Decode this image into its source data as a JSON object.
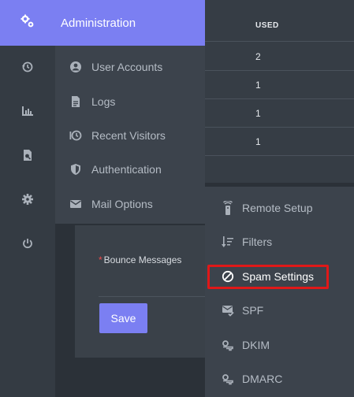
{
  "header": {
    "title": "Administration"
  },
  "rail": {
    "icons": [
      "gears-icon",
      "history-icon",
      "bar-chart-icon",
      "search-file-icon",
      "gear-icon",
      "power-icon"
    ]
  },
  "admin_menu": {
    "items": [
      {
        "label": "User Accounts",
        "icon": "user-circle-icon"
      },
      {
        "label": "Logs",
        "icon": "file-icon"
      },
      {
        "label": "Recent Visitors",
        "icon": "history-icon"
      },
      {
        "label": "Authentication",
        "icon": "shield-icon"
      },
      {
        "label": "Mail Options",
        "icon": "envelope-icon"
      }
    ]
  },
  "table": {
    "header_used": "USED",
    "rows": [
      "2",
      "1",
      "1",
      "1"
    ]
  },
  "form": {
    "required_mark": "*",
    "bounce_label": "Bounce Messages",
    "save_label": "Save"
  },
  "mail_menu": {
    "items": [
      {
        "label": "Remote Setup",
        "icon": "remote-icon"
      },
      {
        "label": "Filters",
        "icon": "filter-sort-icon"
      },
      {
        "label": "Spam Settings",
        "icon": "ban-icon"
      },
      {
        "label": "SPF",
        "icon": "envelope-check-icon"
      },
      {
        "label": "DKIM",
        "icon": "key-icon"
      },
      {
        "label": "DMARC",
        "icon": "key-icon"
      }
    ],
    "highlighted": "Spam Settings"
  },
  "colors": {
    "accent": "#7b7ff2",
    "highlight_border": "#e01818",
    "required": "#ef4b4b"
  }
}
